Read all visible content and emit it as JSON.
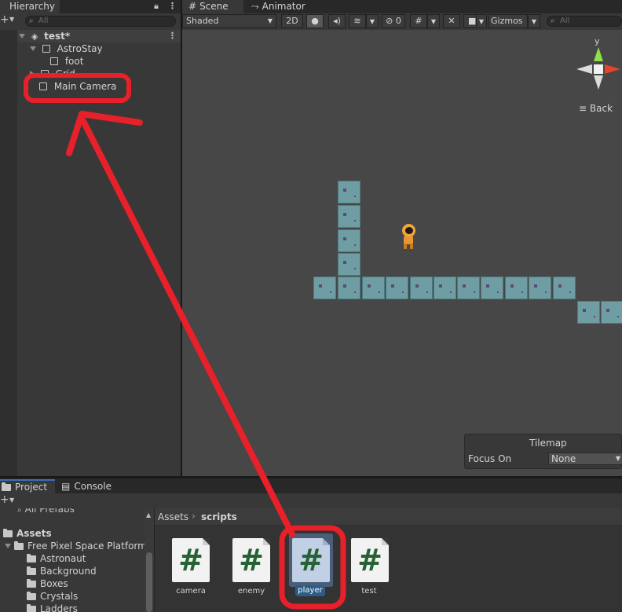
{
  "hierarchy": {
    "tab_label": "Hierarchy",
    "search_placeholder": "All",
    "scene_name": "test*",
    "items": [
      {
        "label": "AstroStay"
      },
      {
        "label": "foot"
      },
      {
        "label": "Grid"
      },
      {
        "label": "Main Camera"
      }
    ]
  },
  "scene": {
    "tabs": [
      {
        "label": "Scene"
      },
      {
        "label": "Animator"
      }
    ],
    "shading_mode": "Shaded",
    "mode_2d": "2D",
    "hidden_count": "0",
    "gizmos_label": "Gizmos",
    "search_placeholder": "All",
    "gizmo_axis_label": "y",
    "gizmo_view_label": "Back",
    "tilemap": {
      "title": "Tilemap",
      "focus_label": "Focus On",
      "focus_value": "None"
    }
  },
  "bottom": {
    "tabs": [
      {
        "label": "Project"
      },
      {
        "label": "Console"
      }
    ],
    "tree": {
      "partial_item": "All Prefabs",
      "root": "Assets",
      "items": [
        {
          "label": "Free Pixel Space Platform"
        },
        {
          "label": "Astronaut"
        },
        {
          "label": "Background"
        },
        {
          "label": "Boxes"
        },
        {
          "label": "Crystals"
        },
        {
          "label": "Ladders"
        }
      ]
    },
    "breadcrumb": {
      "root": "Assets",
      "current": "scripts"
    },
    "files": [
      {
        "name": "camera"
      },
      {
        "name": "enemy"
      },
      {
        "name": "player"
      },
      {
        "name": "test"
      }
    ]
  },
  "colors": {
    "annotation": "#e8202a",
    "panel": "#383838",
    "scene_bg": "#474747",
    "accent": "#3b6fb5"
  }
}
